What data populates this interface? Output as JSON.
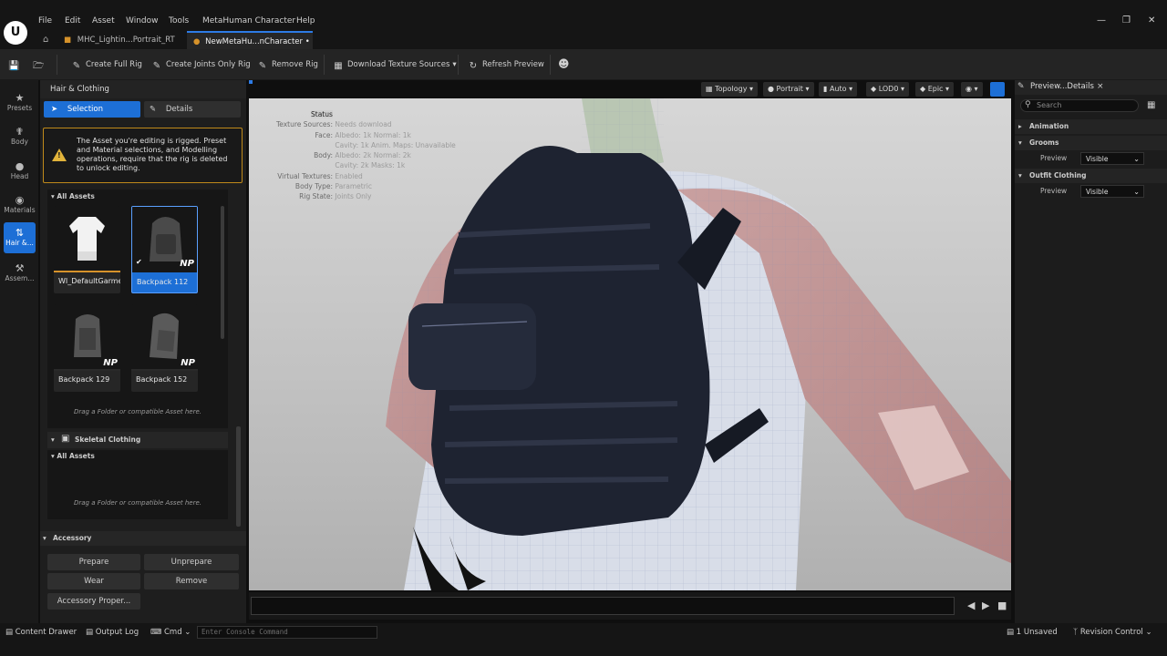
{
  "menu": [
    "File",
    "Edit",
    "Asset",
    "Window",
    "Tools",
    "MetaHuman Character",
    "Help"
  ],
  "tabs": [
    {
      "label": "MHC_Lightin...Portrait_RT"
    },
    {
      "label": "NewMetaHu...nCharacter"
    }
  ],
  "toolbar": {
    "create_full_rig": "Create Full Rig",
    "create_joints_only_rig": "Create Joints Only Rig",
    "remove_rig": "Remove Rig",
    "download_texture_sources": "Download Texture Sources",
    "refresh_preview": "Refresh Preview"
  },
  "lefttabs": [
    {
      "label": "Presets",
      "icon": "star-icon"
    },
    {
      "label": "Body",
      "icon": "body-icon"
    },
    {
      "label": "Head",
      "icon": "head-icon"
    },
    {
      "label": "Materials",
      "icon": "materials-icon"
    },
    {
      "label": "Hair &...",
      "icon": "hair-icon",
      "active": true
    },
    {
      "label": "Assem...",
      "icon": "assembly-icon"
    }
  ],
  "leftpanel": {
    "title": "Hair & Clothing",
    "selection_tab": "Selection",
    "details_tab": "Details",
    "warning": "The Asset you're editing is rigged. Preset and Material selections, and Modelling operations, require that the rig is deleted to unlock editing.",
    "all_assets": "All Assets",
    "assets": [
      {
        "label": "WI_DefaultGarment",
        "badge": ""
      },
      {
        "label": "Backpack 112",
        "badge": "NP",
        "selected": true
      },
      {
        "label": "Backpack 129",
        "badge": "NP"
      },
      {
        "label": "Backpack 152",
        "badge": "NP"
      }
    ],
    "drag_hint": "Drag a Folder or compatible Asset here.",
    "skeletal_clothing": "Skeletal Clothing",
    "all_assets_2": "All Assets",
    "drag_hint_2": "Drag a Folder or compatible Asset here.",
    "accessory": "Accessory",
    "prepare": "Prepare",
    "unprepare": "Unprepare",
    "wear": "Wear",
    "remove": "Remove",
    "accessory_properties": "Accessory Proper..."
  },
  "viewport": {
    "topology": "Topology",
    "portrait": "Portrait",
    "auto": "Auto",
    "lod": "LOD0",
    "epic": "Epic",
    "status_title": "Status",
    "stats": [
      {
        "k": "Texture Sources:",
        "v": "Needs download"
      },
      {
        "k": "Face:",
        "v": "Albedo: 1k Normal: 1k"
      },
      {
        "k": "",
        "v": "Cavity: 1k  Anim. Maps: Unavailable"
      },
      {
        "k": "Body:",
        "v": "Albedo: 2k Normal: 2k"
      },
      {
        "k": "",
        "v": "Cavity: 2k  Masks: 1k"
      },
      {
        "k": "Virtual Textures:",
        "v": "Enabled"
      },
      {
        "k": "Body Type:",
        "v": "Parametric"
      },
      {
        "k": "Rig State:",
        "v": "Joints Only"
      }
    ]
  },
  "rightpanel": {
    "tab": "Preview...Details",
    "search_placeholder": "Search",
    "animation": "Animation",
    "grooms": "Grooms",
    "grooms_preview_label": "Preview",
    "grooms_preview_value": "Visible",
    "outfit_clothing": "Outfit Clothing",
    "outfit_preview_label": "Preview",
    "outfit_preview_value": "Visible"
  },
  "statusbar": {
    "content_drawer": "Content Drawer",
    "output_log": "Output Log",
    "cmd": "Cmd",
    "console_placeholder": "Enter Console Command",
    "unsaved": "1 Unsaved",
    "revision_control": "Revision Control"
  },
  "colors": {
    "accent": "#1d6fd6",
    "warning": "#c08a1a",
    "asset_bar": "#d6922a"
  }
}
